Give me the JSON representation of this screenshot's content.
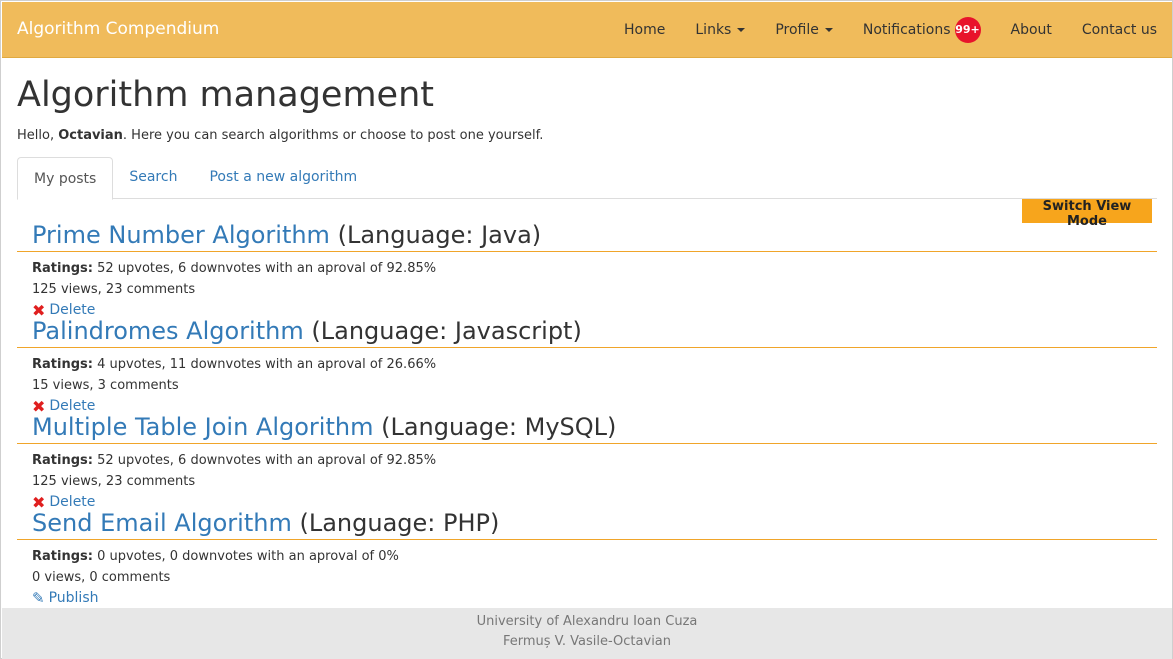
{
  "navbar": {
    "brand": "Algorithm Compendium",
    "items": [
      {
        "label": "Home"
      },
      {
        "label": "Links"
      },
      {
        "label": "Profile"
      },
      {
        "label": "Notifications"
      },
      {
        "label": "About"
      },
      {
        "label": "Contact us"
      }
    ],
    "notifications_badge": "99+",
    "colors": {
      "bar": "#f0bb5b",
      "badge": "#e8132b"
    }
  },
  "page": {
    "title": "Algorithm management",
    "intro_prefix": "Hello, ",
    "user": "Octavian",
    "intro_suffix": ". Here you can search algorithms or choose to post one yourself."
  },
  "tabs": [
    {
      "label": "My posts"
    },
    {
      "label": "Search"
    },
    {
      "label": "Post a new algorithm"
    }
  ],
  "switch_view_label": "Switch View Mode",
  "posts": [
    {
      "name": "Prime Number Algorithm",
      "language": "(Language: Java)",
      "ratings_label": "Ratings:",
      "ratings": "52 upvotes, 6 downvotes with an aproval of 92.85%",
      "stats": "125 views, 23 comments",
      "action": "Delete"
    },
    {
      "name": "Palindromes Algorithm",
      "language": "(Language: Javascript)",
      "ratings_label": "Ratings:",
      "ratings": "4 upvotes, 11 downvotes with an aproval of 26.66%",
      "stats": "15 views, 3 comments",
      "action": "Delete"
    },
    {
      "name": "Multiple Table Join Algorithm",
      "language": "(Language: MySQL)",
      "ratings_label": "Ratings:",
      "ratings": "52 upvotes, 6 downvotes with an aproval of 92.85%",
      "stats": "125 views, 23 comments",
      "action": "Delete"
    },
    {
      "name": "Send Email Algorithm",
      "language": "(Language: PHP)",
      "ratings_label": "Ratings:",
      "ratings": "0 upvotes, 0 downvotes with an aproval of 0%",
      "stats": "0 views, 0 comments",
      "action": "Publish"
    }
  ],
  "footer": {
    "line1": "University of Alexandru Ioan Cuza",
    "line2": "Fermuș V. Vasile-Octavian"
  }
}
